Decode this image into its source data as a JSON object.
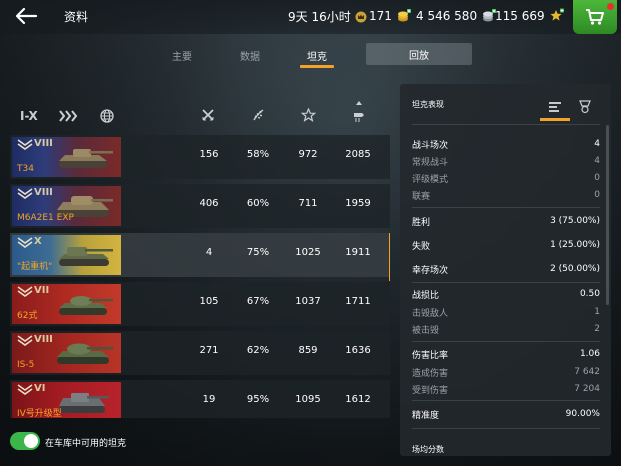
{
  "header": {
    "title": "资料",
    "timer": "9天 16小时",
    "gold": "171",
    "credits": "4 546 580",
    "free_xp": "115 669"
  },
  "tabs": [
    {
      "label": "主要"
    },
    {
      "label": "数据"
    },
    {
      "label": "坦克"
    },
    {
      "label": "回放"
    }
  ],
  "filters": {
    "tier_label": "I-X"
  },
  "tanks": [
    {
      "tier": "VIII",
      "name": "T34",
      "battles": "156",
      "winrate": "58%",
      "avg_xp": "972",
      "avg_damage": "2085",
      "flag": "usa"
    },
    {
      "tier": "VIII",
      "name": "M6A2E1 EXP",
      "battles": "406",
      "winrate": "60%",
      "avg_xp": "711",
      "avg_damage": "1959",
      "flag": "usa"
    },
    {
      "tier": "X",
      "name": "\"起重机\"",
      "battles": "4",
      "winrate": "75%",
      "avg_xp": "1025",
      "avg_damage": "1911",
      "flag": "sweden"
    },
    {
      "tier": "VII",
      "name": "62式",
      "battles": "105",
      "winrate": "67%",
      "avg_xp": "1037",
      "avg_damage": "1711",
      "flag": "china"
    },
    {
      "tier": "VIII",
      "name": "IS-5",
      "battles": "271",
      "winrate": "62%",
      "avg_xp": "859",
      "avg_damage": "1636",
      "flag": "ussr"
    },
    {
      "tier": "VI",
      "name": "IV号升级型",
      "battles": "19",
      "winrate": "95%",
      "avg_xp": "1095",
      "avg_damage": "1612",
      "flag": "germany"
    }
  ],
  "panel": {
    "title": "坦克表现",
    "rows": [
      {
        "label": "战斗场次",
        "value": "4",
        "kind": "main"
      },
      {
        "label": "常规战斗",
        "value": "4",
        "kind": "sub"
      },
      {
        "label": "评级模式",
        "value": "0",
        "kind": "sub"
      },
      {
        "label": "联赛",
        "value": "0",
        "kind": "sub"
      },
      {
        "label": "胜利",
        "value": "3 (75.00%)",
        "kind": "main"
      },
      {
        "label": "失败",
        "value": "1 (25.00%)",
        "kind": "main"
      },
      {
        "label": "幸存场次",
        "value": "2 (50.00%)",
        "kind": "main"
      },
      {
        "label": "战损比",
        "value": "0.50",
        "kind": "main"
      },
      {
        "label": "击毁敌人",
        "value": "1",
        "kind": "sub"
      },
      {
        "label": "被击毁",
        "value": "2",
        "kind": "sub"
      },
      {
        "label": "伤害比率",
        "value": "1.06",
        "kind": "main"
      },
      {
        "label": "造成伤害",
        "value": "7 642",
        "kind": "sub"
      },
      {
        "label": "受到伤害",
        "value": "7 204",
        "kind": "sub"
      },
      {
        "label": "精准度",
        "value": "90.00%",
        "kind": "main"
      },
      {
        "label": "场均分数",
        "value": "",
        "kind": "sub"
      }
    ]
  },
  "footer": {
    "toggle_label": "在车库中可用的坦克"
  },
  "colors": {
    "accent": "#f3a32a",
    "toggle_on": "#3cb64a",
    "shop": "#3aa82e"
  }
}
